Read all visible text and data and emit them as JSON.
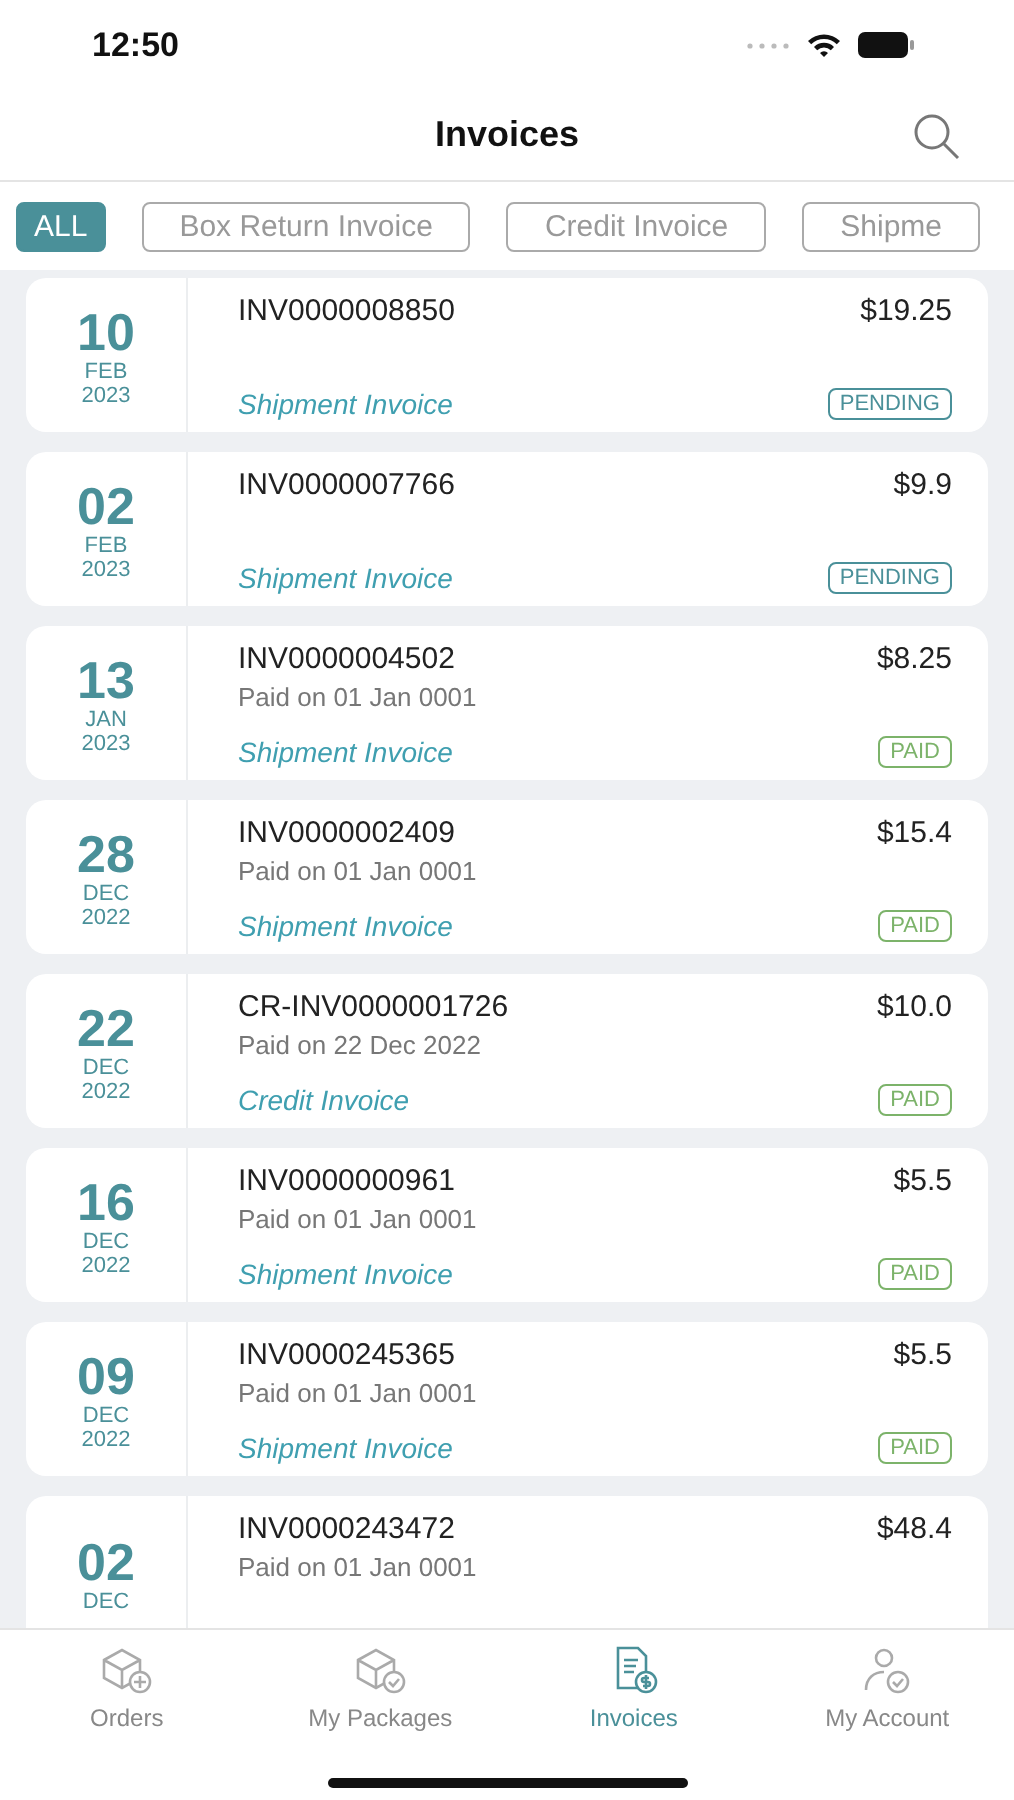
{
  "status_bar": {
    "time": "12:50"
  },
  "header": {
    "title": "Invoices"
  },
  "filters": [
    {
      "label": "ALL",
      "selected": true
    },
    {
      "label": "Box Return Invoice",
      "selected": false
    },
    {
      "label": "Credit Invoice",
      "selected": false
    },
    {
      "label": "Shipme",
      "selected": false
    }
  ],
  "invoices": [
    {
      "day": "10",
      "month": "FEB",
      "year": "2023",
      "number": "INV0000008850",
      "amount": "$19.25",
      "type": "Shipment Invoice",
      "status": {
        "text": "PENDING",
        "kind": "pending"
      }
    },
    {
      "day": "02",
      "month": "FEB",
      "year": "2023",
      "number": "INV0000007766",
      "amount": "$9.9",
      "type": "Shipment Invoice",
      "status": {
        "text": "PENDING",
        "kind": "pending"
      }
    },
    {
      "day": "13",
      "month": "JAN",
      "year": "2023",
      "number": "INV0000004502",
      "amount": "$8.25",
      "paid_note": "Paid on 01 Jan 0001",
      "type": "Shipment Invoice",
      "status": {
        "text": "PAID",
        "kind": "paid"
      }
    },
    {
      "day": "28",
      "month": "DEC",
      "year": "2022",
      "number": "INV0000002409",
      "amount": "$15.4",
      "paid_note": "Paid on 01 Jan 0001",
      "type": "Shipment Invoice",
      "status": {
        "text": "PAID",
        "kind": "paid"
      }
    },
    {
      "day": "22",
      "month": "DEC",
      "year": "2022",
      "number": "CR-INV0000001726",
      "amount": "$10.0",
      "paid_note": "Paid on 22 Dec 2022",
      "type": "Credit Invoice",
      "status": {
        "text": "PAID",
        "kind": "paid"
      }
    },
    {
      "day": "16",
      "month": "DEC",
      "year": "2022",
      "number": "INV0000000961",
      "amount": "$5.5",
      "paid_note": "Paid on 01 Jan 0001",
      "type": "Shipment Invoice",
      "status": {
        "text": "PAID",
        "kind": "paid"
      }
    },
    {
      "day": "09",
      "month": "DEC",
      "year": "2022",
      "number": "INV0000245365",
      "amount": "$5.5",
      "paid_note": "Paid on 01 Jan 0001",
      "type": "Shipment Invoice",
      "status": {
        "text": "PAID",
        "kind": "paid"
      }
    },
    {
      "day": "02",
      "month": "DEC",
      "number": "INV0000243472",
      "amount": "$48.4",
      "paid_note": "Paid on 01 Jan 0001"
    }
  ],
  "tab_bar": [
    {
      "label": "Orders",
      "selected": false
    },
    {
      "label": "My Packages",
      "selected": false
    },
    {
      "label": "Invoices",
      "selected": true
    },
    {
      "label": "My Account",
      "selected": false
    }
  ]
}
